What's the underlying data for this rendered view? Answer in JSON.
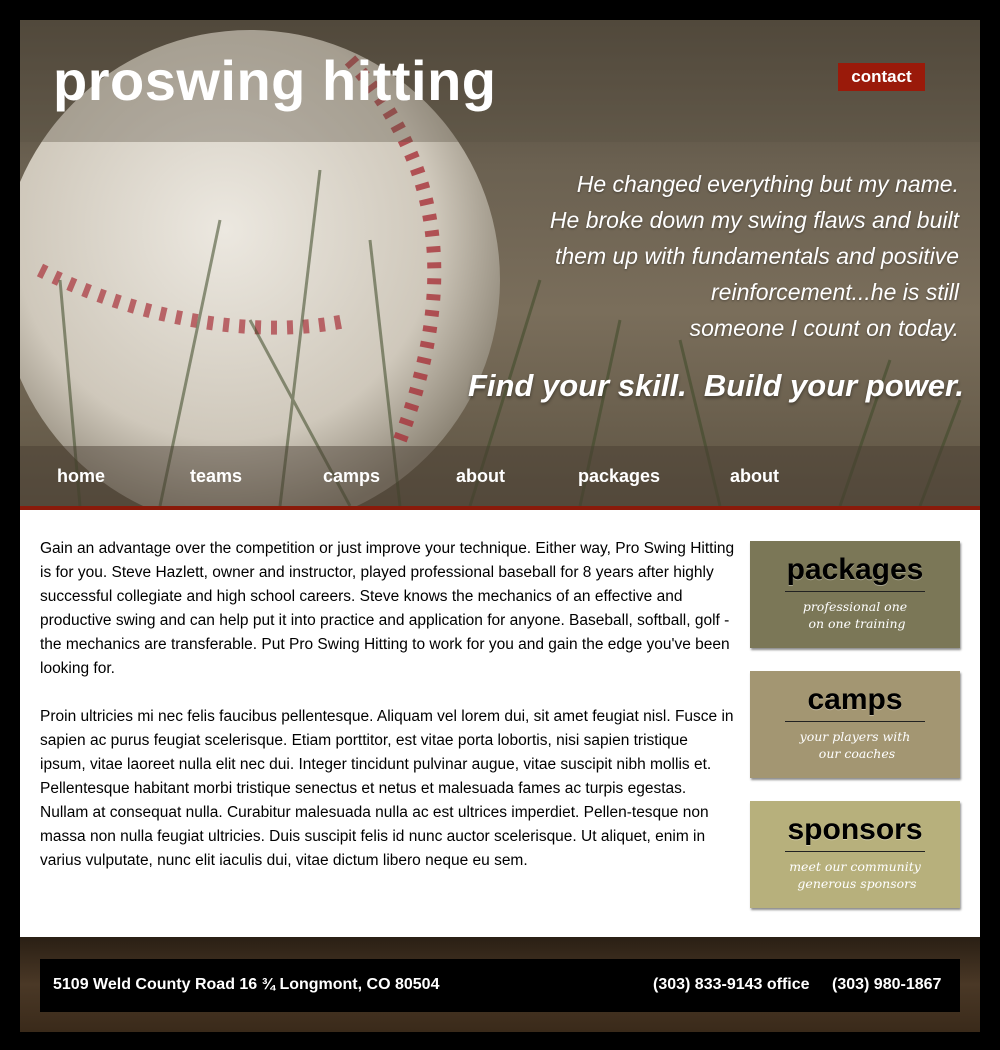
{
  "header": {
    "site_title": "proswing hitting",
    "contact_label": "contact",
    "quote_lines": [
      "He changed everything but my name.",
      "He broke down my swing flaws and built",
      "them up with fundamentals and positive",
      "reinforcement...he is still",
      "someone I count on today."
    ],
    "tagline": "Find your skill.  Build your power."
  },
  "nav": {
    "items": [
      {
        "label": "home"
      },
      {
        "label": "teams"
      },
      {
        "label": "camps"
      },
      {
        "label": "about"
      },
      {
        "label": "packages"
      },
      {
        "label": "about"
      }
    ]
  },
  "main": {
    "paragraphs": [
      "Gain an advantage over the competition or just improve your technique. Either way, Pro Swing Hitting is for you. Steve Hazlett, owner and instructor, played professional baseball for 8 years after highly successful collegiate and high school careers. Steve knows the mechanics of an effective and productive swing and can help put it into practice and application for anyone. Baseball, softball, golf - the mechanics are transferable. Put Pro Swing Hitting to work for you and gain the edge you've been looking for.",
      "Proin ultricies mi nec felis faucibus pellentesque. Aliquam vel lorem dui, sit amet feugiat nisl. Fusce in sapien ac purus feugiat scelerisque. Etiam porttitor, est vitae porta lobortis, nisi sapien tristique ipsum, vitae laoreet nulla elit nec dui. Integer tincidunt pulvinar augue, vitae suscipit nibh mollis et. Pellentesque habitant morbi tristique senectus et netus et malesuada fames ac turpis egestas. Nullam at consequat nulla. Curabitur malesuada nulla ac est ultrices imperdiet. Pellen-tesque non massa non nulla feugiat ultricies. Duis suscipit felis id nunc auctor scelerisque. Ut aliquet, enim in varius vulputate, nunc elit iaculis dui, vitae dictum libero neque eu sem."
    ]
  },
  "sidebar": {
    "boxes": [
      {
        "title": "packages",
        "subtitle": "professional one\n on one training",
        "color": "#7b7757"
      },
      {
        "title": "camps",
        "subtitle": "your players with\n our coaches",
        "color": "#a39672"
      },
      {
        "title": "sponsors",
        "subtitle": "meet our community\n generous sponsors",
        "color": "#b7b07c"
      }
    ]
  },
  "footer": {
    "address": "5109 Weld County Road 16 ¾ Longmont, CO 80504",
    "phone_office": "(303) 833-9143 office",
    "phone_mobile": "(303) 980-1867"
  },
  "colors": {
    "contact_red": "#9a1a0a",
    "hero_rule": "#8a1a0a"
  }
}
